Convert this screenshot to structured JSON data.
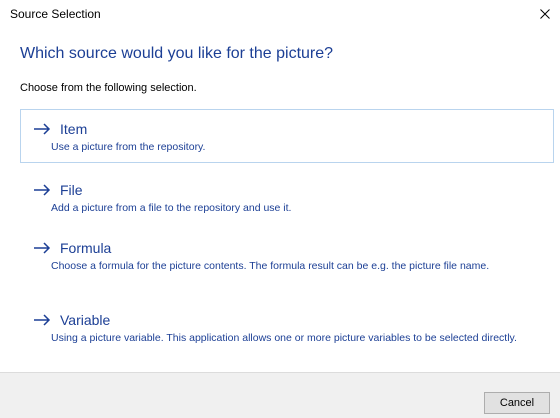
{
  "window": {
    "title": "Source Selection",
    "close_icon": "close-icon"
  },
  "heading": "Which source would you like for the picture?",
  "subheading": "Choose from the following selection.",
  "options": [
    {
      "label": "Item",
      "description": "Use a picture from the repository.",
      "selected": true
    },
    {
      "label": "File",
      "description": "Add a picture from a file to the repository and use it.",
      "selected": false
    },
    {
      "label": "Formula",
      "description": "Choose a formula for the picture contents. The formula result can be e.g. the picture file name.",
      "selected": false
    },
    {
      "label": "Variable",
      "description": "Using a picture variable. This application allows one or more picture variables to be selected directly.",
      "selected": false
    }
  ],
  "footer": {
    "cancel_label": "Cancel"
  },
  "colors": {
    "accent": "#1c3f95",
    "selected_border": "#b9d4ee",
    "footer_bg": "#f0f0f0"
  }
}
